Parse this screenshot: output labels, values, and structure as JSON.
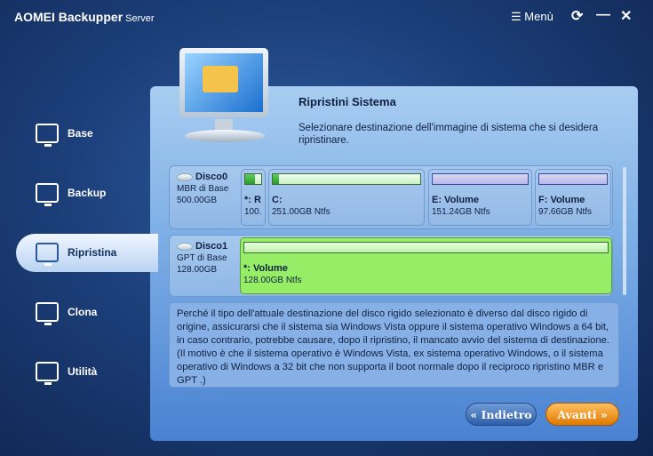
{
  "app": {
    "title": "AOMEI Backupper",
    "edition": "Server",
    "menu_label": "Menù"
  },
  "sidebar": {
    "items": [
      {
        "label": "Base"
      },
      {
        "label": "Backup"
      },
      {
        "label": "Ripristina"
      },
      {
        "label": "Clona"
      },
      {
        "label": "Utilità"
      }
    ],
    "selected": "Ripristina"
  },
  "main": {
    "title": "Ripristini Sistema",
    "description": "Selezionare destinazione dell'immagine di sistema che si desidera ripristinare."
  },
  "disks": [
    {
      "name": "Disco0",
      "type": "MBR di Base",
      "size": "500.00GB",
      "partitions": [
        {
          "label": "*: R",
          "detail": "100.",
          "used_pct": 60
        },
        {
          "label": "C:",
          "detail": "251.00GB Ntfs",
          "used_pct": 4
        },
        {
          "label": "E: Volume",
          "detail": "151.24GB Ntfs",
          "used_pct": 0
        },
        {
          "label": "F: Volume",
          "detail": "97.66GB Ntfs",
          "used_pct": 0
        }
      ]
    },
    {
      "name": "Disco1",
      "type": "GPT di Base",
      "size": "128.00GB",
      "selected": true,
      "partitions": [
        {
          "label": "*: Volume",
          "detail": "128.00GB Ntfs",
          "used_pct": 0
        }
      ]
    }
  ],
  "warning": "Perché il tipo dell'attuale destinazione del disco rigido selezionato è diverso dal disco rigido di origine, assicurarsi che il sistema sia Windows Vista oppure il sistema operativo Windows a 64 bit, in caso contrario, potrebbe causare, dopo il ripristino, il mancato avvio del sistema di destinazione. (Il motivo è che il sistema operativo è Windows Vista, ex sistema operativo Windows, o il sistema operativo di Windows a 32 bit che non supporta il boot normale dopo il reciproco ripristino MBR e GPT .)",
  "buttons": {
    "back": "« Indietro",
    "next": "Avanti »"
  }
}
